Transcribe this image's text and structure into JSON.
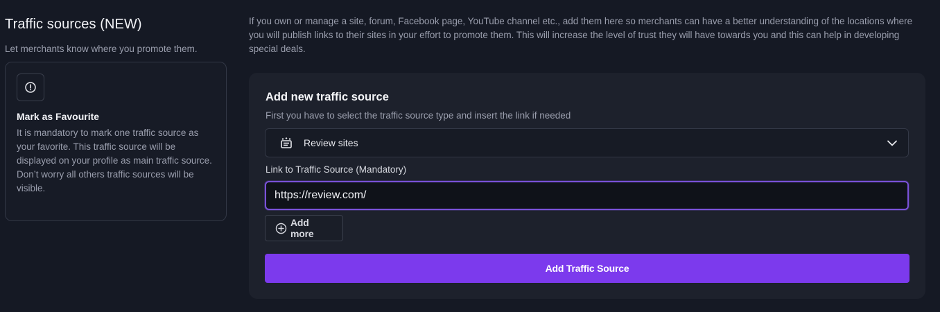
{
  "section": {
    "title": "Traffic sources (NEW)",
    "subtitle": "Let merchants know where you promote them."
  },
  "info_card": {
    "icon": "alert-circle-icon",
    "title": "Mark as Favourite",
    "body_line1": "It is mandatory to mark one traffic source as your favorite. This traffic source will be displayed on your profile as main traffic source.",
    "body_line2": "Don’t worry all others traffic sources will be visible."
  },
  "description": "If you own or manage a site, forum, Facebook page, YouTube channel etc., add them here so merchants can have a better understanding of the locations where you will publish links to their sites in your effort to promote them. This will increase the level of trust they will have towards you and this can help in developing special deals.",
  "form": {
    "title": "Add new traffic source",
    "subtitle": "First you have to select the traffic source type and insert the link if needed",
    "type_select": {
      "icon": "review-sites-icon",
      "selected": "Review sites"
    },
    "link_label": "Link to Traffic Source (Mandatory)",
    "link_value": "https://review.com/",
    "add_more_label": "Add more",
    "submit_label": "Add Traffic Source"
  },
  "colors": {
    "background": "#151924",
    "panel": "#1d212c",
    "accent": "#7c3aed",
    "focus_border": "#7a52d9"
  }
}
